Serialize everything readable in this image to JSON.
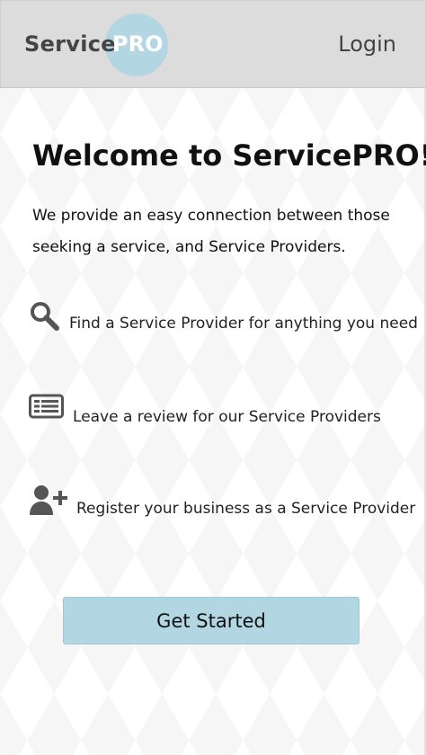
{
  "header": {
    "logo_service": "Service",
    "logo_pro": "PRO",
    "login_label": "Login"
  },
  "main": {
    "title": "Welcome to ServicePRO!",
    "intro": "We provide an easy connection between those seeking a service, and Service Providers.",
    "features": [
      {
        "icon": "search-icon",
        "label": "Find a Service Provider for anything you need"
      },
      {
        "icon": "list-icon",
        "label": "Leave a review for our Service Providers"
      },
      {
        "icon": "add-user-icon",
        "label": "Register your business as a Service Provider"
      }
    ],
    "cta_label": "Get Started"
  },
  "colors": {
    "header_bg": "#dcdcdc",
    "accent": "#b3d6e3",
    "text_dark": "#444444"
  }
}
